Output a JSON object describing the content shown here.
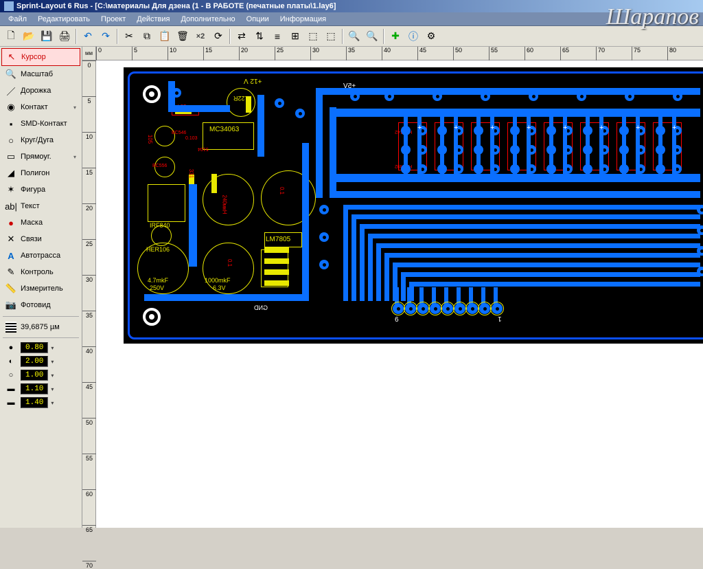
{
  "app_title": "Sprint-Layout 6 Rus - [C:\\материалы Для дзена (1 - В РАБОТЕ (печатные платы\\1.lay6]",
  "menu": [
    "Файл",
    "Редактировать",
    "Проект",
    "Действия",
    "Дополнительно",
    "Опции",
    "Информация"
  ],
  "watermark": "Шарапов",
  "tools": [
    {
      "icon": "↖",
      "label": "Курсор",
      "active": true
    },
    {
      "icon": "🔍",
      "label": "Масштаб"
    },
    {
      "icon": "／",
      "label": "Дорожка"
    },
    {
      "icon": "◉",
      "label": "Контакт",
      "arrow": true
    },
    {
      "icon": "▪",
      "label": "SMD-Контакт"
    },
    {
      "icon": "○",
      "label": "Круг/Дуга"
    },
    {
      "icon": "▭",
      "label": "Прямоуг.",
      "arrow": true
    },
    {
      "icon": "◢",
      "label": "Полигон"
    },
    {
      "icon": "✶",
      "label": "Фигура"
    },
    {
      "icon": "ab|",
      "label": "Текст"
    },
    {
      "icon": "●",
      "label": "Маска",
      "red": true
    },
    {
      "icon": "✕",
      "label": "Связи"
    },
    {
      "icon": "A",
      "label": "Автотрасса",
      "blue": true
    },
    {
      "icon": "✎",
      "label": "Контроль"
    },
    {
      "icon": "📏",
      "label": "Измеритель"
    },
    {
      "icon": "📷",
      "label": "Фотовид"
    }
  ],
  "grid_value": "39,6875 µм",
  "params": [
    {
      "icon": "●",
      "val": "0.80"
    },
    {
      "icon": "◐",
      "val": "2.00"
    },
    {
      "icon": "○",
      "val": "1.00"
    },
    {
      "icon": "▬",
      "val": "1.10"
    },
    {
      "icon": "▬",
      "val": "1.40"
    }
  ],
  "ruler_unit": "мм",
  "ruler_h": [
    "0",
    "5",
    "10",
    "15",
    "20",
    "25",
    "30",
    "35",
    "40",
    "45",
    "50",
    "55",
    "60",
    "65",
    "70",
    "75",
    "80"
  ],
  "ruler_v": [
    "0",
    "5",
    "10",
    "15",
    "20",
    "25",
    "30",
    "35",
    "40",
    "45",
    "50",
    "55",
    "60",
    "65",
    "70"
  ],
  "zoom_x2": "×2",
  "pcb_labels": {
    "v12": "+12 V",
    "v5": "+5V",
    "r22": "0.22R",
    "r394": "394",
    "bc546": "BC546",
    "mc34063": "MC34063",
    "r105": "105",
    "k0103": "0.103",
    "bc556": "BC556",
    "r5104": "5104",
    "r331": "331",
    "irf840": "IRF840",
    "l240": "240мкН",
    "c01a": "0.1",
    "her106": "HER106",
    "lm7805": "LM7805",
    "c47": "4.7mkF",
    "v250": "250V",
    "c01b": "0.1",
    "c1000": "1000mkF",
    "v63": "6.3V",
    "gnd": "GND",
    "pin9": "9",
    "pin1": "1",
    "ha1": "НА8142",
    "ha2": "НА1492"
  }
}
